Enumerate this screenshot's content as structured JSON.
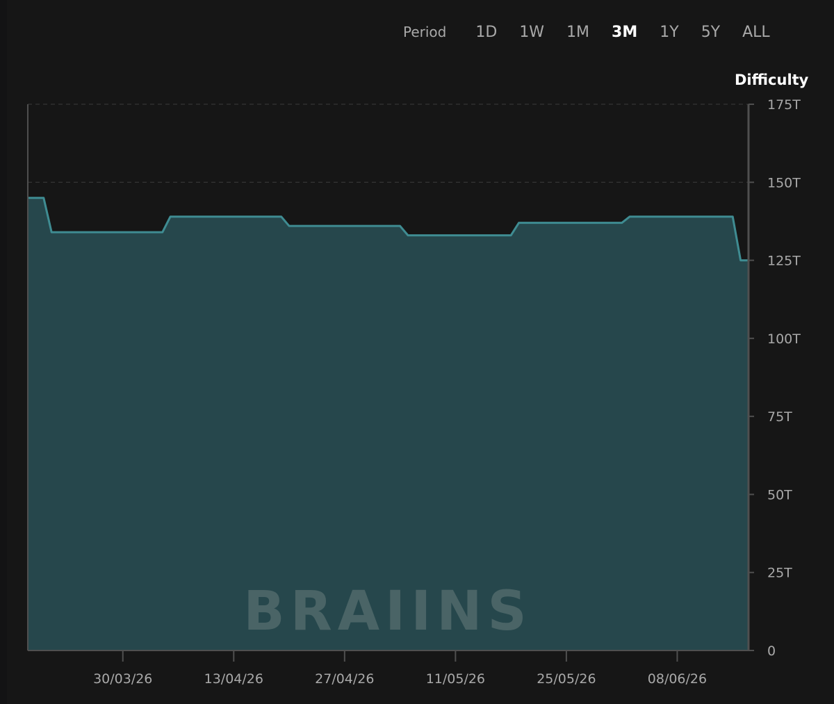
{
  "period_selector": {
    "label": "Period",
    "options": [
      "1D",
      "1W",
      "1M",
      "3M",
      "1Y",
      "5Y",
      "ALL"
    ],
    "active": "3M"
  },
  "watermark": "BRAIINS",
  "colors": {
    "background": "#161616",
    "line": "#3f8c92",
    "fill": "#26474c",
    "grid": "#3c3c3c",
    "axis": "#4f4f4f",
    "text": "#a9a9a9",
    "active_text": "#ffffff"
  },
  "chart_data": {
    "type": "area",
    "title": "Difficulty",
    "series": [
      {
        "name": "Difficulty",
        "x": [
          "2026-03-18",
          "2026-03-20",
          "2026-03-21",
          "2026-03-22",
          "2026-04-04",
          "2026-04-05",
          "2026-04-19",
          "2026-04-20",
          "2026-05-04",
          "2026-05-05",
          "2026-05-18",
          "2026-05-19",
          "2026-06-01",
          "2026-06-02",
          "2026-06-15",
          "2026-06-16",
          "2026-06-17"
        ],
        "values": [
          145,
          145,
          134,
          134,
          134,
          139,
          139,
          136,
          136,
          133,
          133,
          137,
          137,
          139,
          139,
          125,
          125
        ]
      }
    ],
    "xlim": [
      "2026-03-18",
      "2026-06-17"
    ],
    "ylim": [
      0,
      175
    ],
    "y_ticks": [
      0,
      25,
      50,
      75,
      100,
      125,
      150,
      175
    ],
    "y_tick_labels": [
      "0",
      "25T",
      "50T",
      "75T",
      "100T",
      "125T",
      "150T",
      "175T"
    ],
    "x_ticks": [
      "2026-03-30",
      "2026-04-13",
      "2026-04-27",
      "2026-05-11",
      "2026-05-25",
      "2026-06-08"
    ],
    "x_tick_labels": [
      "30/03/26",
      "13/04/26",
      "27/04/26",
      "11/05/26",
      "25/05/26",
      "08/06/26"
    ],
    "grid": true,
    "y_axis_position": "right"
  }
}
